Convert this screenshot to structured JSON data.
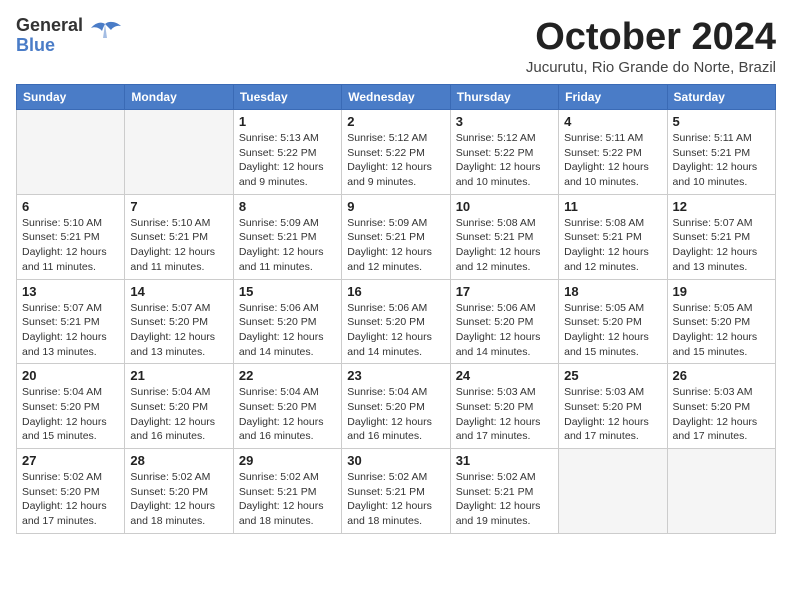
{
  "header": {
    "logo_general": "General",
    "logo_blue": "Blue",
    "month": "October 2024",
    "location": "Jucurutu, Rio Grande do Norte, Brazil"
  },
  "weekdays": [
    "Sunday",
    "Monday",
    "Tuesday",
    "Wednesday",
    "Thursday",
    "Friday",
    "Saturday"
  ],
  "weeks": [
    [
      {
        "day": "",
        "info": ""
      },
      {
        "day": "",
        "info": ""
      },
      {
        "day": "1",
        "info": "Sunrise: 5:13 AM\nSunset: 5:22 PM\nDaylight: 12 hours and 9 minutes."
      },
      {
        "day": "2",
        "info": "Sunrise: 5:12 AM\nSunset: 5:22 PM\nDaylight: 12 hours and 9 minutes."
      },
      {
        "day": "3",
        "info": "Sunrise: 5:12 AM\nSunset: 5:22 PM\nDaylight: 12 hours and 10 minutes."
      },
      {
        "day": "4",
        "info": "Sunrise: 5:11 AM\nSunset: 5:22 PM\nDaylight: 12 hours and 10 minutes."
      },
      {
        "day": "5",
        "info": "Sunrise: 5:11 AM\nSunset: 5:21 PM\nDaylight: 12 hours and 10 minutes."
      }
    ],
    [
      {
        "day": "6",
        "info": "Sunrise: 5:10 AM\nSunset: 5:21 PM\nDaylight: 12 hours and 11 minutes."
      },
      {
        "day": "7",
        "info": "Sunrise: 5:10 AM\nSunset: 5:21 PM\nDaylight: 12 hours and 11 minutes."
      },
      {
        "day": "8",
        "info": "Sunrise: 5:09 AM\nSunset: 5:21 PM\nDaylight: 12 hours and 11 minutes."
      },
      {
        "day": "9",
        "info": "Sunrise: 5:09 AM\nSunset: 5:21 PM\nDaylight: 12 hours and 12 minutes."
      },
      {
        "day": "10",
        "info": "Sunrise: 5:08 AM\nSunset: 5:21 PM\nDaylight: 12 hours and 12 minutes."
      },
      {
        "day": "11",
        "info": "Sunrise: 5:08 AM\nSunset: 5:21 PM\nDaylight: 12 hours and 12 minutes."
      },
      {
        "day": "12",
        "info": "Sunrise: 5:07 AM\nSunset: 5:21 PM\nDaylight: 12 hours and 13 minutes."
      }
    ],
    [
      {
        "day": "13",
        "info": "Sunrise: 5:07 AM\nSunset: 5:21 PM\nDaylight: 12 hours and 13 minutes."
      },
      {
        "day": "14",
        "info": "Sunrise: 5:07 AM\nSunset: 5:20 PM\nDaylight: 12 hours and 13 minutes."
      },
      {
        "day": "15",
        "info": "Sunrise: 5:06 AM\nSunset: 5:20 PM\nDaylight: 12 hours and 14 minutes."
      },
      {
        "day": "16",
        "info": "Sunrise: 5:06 AM\nSunset: 5:20 PM\nDaylight: 12 hours and 14 minutes."
      },
      {
        "day": "17",
        "info": "Sunrise: 5:06 AM\nSunset: 5:20 PM\nDaylight: 12 hours and 14 minutes."
      },
      {
        "day": "18",
        "info": "Sunrise: 5:05 AM\nSunset: 5:20 PM\nDaylight: 12 hours and 15 minutes."
      },
      {
        "day": "19",
        "info": "Sunrise: 5:05 AM\nSunset: 5:20 PM\nDaylight: 12 hours and 15 minutes."
      }
    ],
    [
      {
        "day": "20",
        "info": "Sunrise: 5:04 AM\nSunset: 5:20 PM\nDaylight: 12 hours and 15 minutes."
      },
      {
        "day": "21",
        "info": "Sunrise: 5:04 AM\nSunset: 5:20 PM\nDaylight: 12 hours and 16 minutes."
      },
      {
        "day": "22",
        "info": "Sunrise: 5:04 AM\nSunset: 5:20 PM\nDaylight: 12 hours and 16 minutes."
      },
      {
        "day": "23",
        "info": "Sunrise: 5:04 AM\nSunset: 5:20 PM\nDaylight: 12 hours and 16 minutes."
      },
      {
        "day": "24",
        "info": "Sunrise: 5:03 AM\nSunset: 5:20 PM\nDaylight: 12 hours and 17 minutes."
      },
      {
        "day": "25",
        "info": "Sunrise: 5:03 AM\nSunset: 5:20 PM\nDaylight: 12 hours and 17 minutes."
      },
      {
        "day": "26",
        "info": "Sunrise: 5:03 AM\nSunset: 5:20 PM\nDaylight: 12 hours and 17 minutes."
      }
    ],
    [
      {
        "day": "27",
        "info": "Sunrise: 5:02 AM\nSunset: 5:20 PM\nDaylight: 12 hours and 17 minutes."
      },
      {
        "day": "28",
        "info": "Sunrise: 5:02 AM\nSunset: 5:20 PM\nDaylight: 12 hours and 18 minutes."
      },
      {
        "day": "29",
        "info": "Sunrise: 5:02 AM\nSunset: 5:21 PM\nDaylight: 12 hours and 18 minutes."
      },
      {
        "day": "30",
        "info": "Sunrise: 5:02 AM\nSunset: 5:21 PM\nDaylight: 12 hours and 18 minutes."
      },
      {
        "day": "31",
        "info": "Sunrise: 5:02 AM\nSunset: 5:21 PM\nDaylight: 12 hours and 19 minutes."
      },
      {
        "day": "",
        "info": ""
      },
      {
        "day": "",
        "info": ""
      }
    ]
  ]
}
